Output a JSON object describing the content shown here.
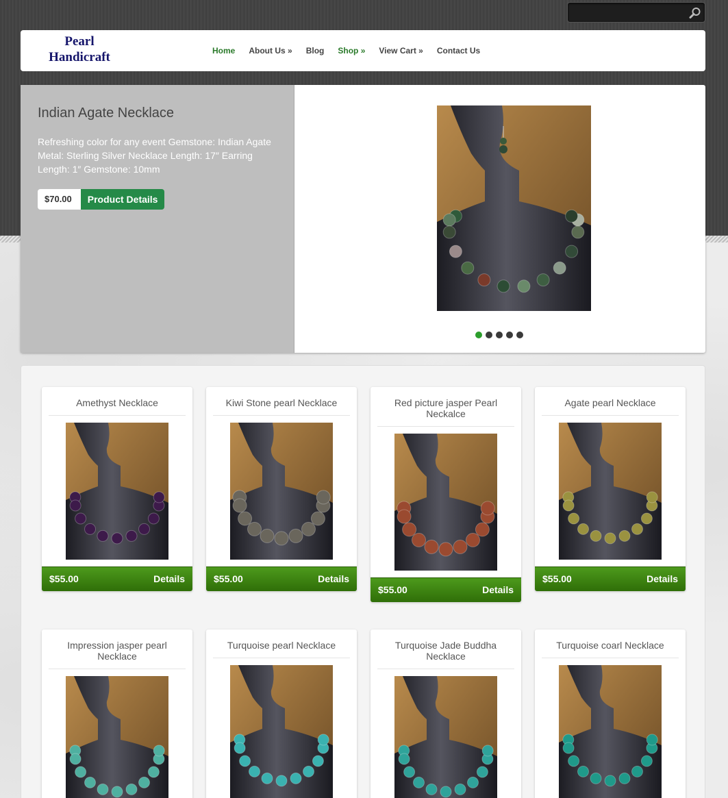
{
  "search": {
    "placeholder": ""
  },
  "logo": {
    "line1": "Pearl",
    "line2": "Handicraft"
  },
  "nav": [
    {
      "label": "Home"
    },
    {
      "label": "About Us »"
    },
    {
      "label": "Blog"
    },
    {
      "label": "Shop »"
    },
    {
      "label": "View Cart »"
    },
    {
      "label": "Contact Us"
    }
  ],
  "featured": {
    "title": "Indian Agate Necklace",
    "description": "Refreshing color for any event Gemstone: Indian Agate Metal: Sterling Silver Necklace Length: 17″ Earring Length: 1″ Gemstone: 10mm",
    "price": "$70.00",
    "button": "Product Details",
    "slide_count": 5,
    "active_slide": 1
  },
  "products": [
    {
      "title": "Amethyst Necklace",
      "price": "$55.00",
      "details": "Details",
      "bead_color": "#3d1a4a"
    },
    {
      "title": "Kiwi Stone pearl Necklace",
      "price": "$55.00",
      "details": "Details",
      "bead_color": "#6a665c"
    },
    {
      "title": "Red picture jasper Pearl Neckalce",
      "price": "$55.00",
      "details": "Details",
      "bead_color": "#9a4a30"
    },
    {
      "title": "Agate pearl Necklace",
      "price": "$55.00",
      "details": "Details",
      "bead_color": "#9a9240"
    },
    {
      "title": "Impression jasper pearl Necklace",
      "price": "",
      "details": "",
      "bead_color": "#4fb0a0"
    },
    {
      "title": "Turquoise pearl Necklace",
      "price": "",
      "details": "",
      "bead_color": "#3ab2b0"
    },
    {
      "title": "Turquoise Jade Buddha Necklace",
      "price": "",
      "details": "",
      "bead_color": "#2fa39a"
    },
    {
      "title": "Turquoise coarl Necklace",
      "price": "",
      "details": "",
      "bead_color": "#1f9a8a"
    }
  ],
  "colors": {
    "nav_active": "#2a7a2a",
    "details_button": "#258a48",
    "price_bar": "#3f8512",
    "slider_active": "#2c9e2c"
  }
}
